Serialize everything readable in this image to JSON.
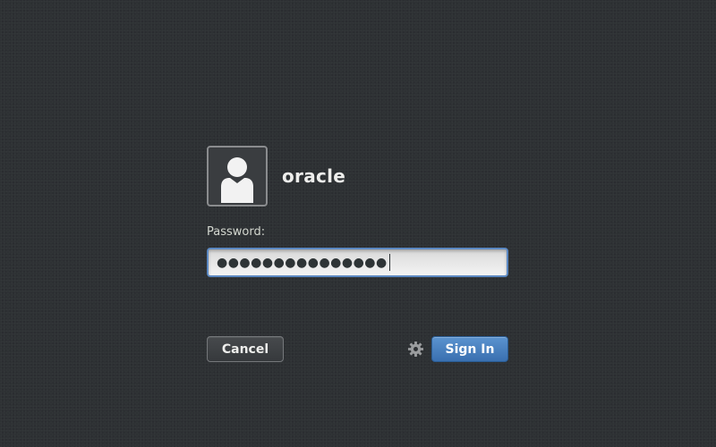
{
  "user": {
    "name": "oracle",
    "avatar_icon": "user-silhouette-icon"
  },
  "password": {
    "label": "Password:",
    "masked_value": "●●●●●●●●●●●●●●●",
    "focus_color": "#5b88c2"
  },
  "actions": {
    "cancel_label": "Cancel",
    "signin_label": "Sign In",
    "session_icon": "gear-icon",
    "signin_color": "#3a70b0"
  },
  "background_color": "#2e3134"
}
